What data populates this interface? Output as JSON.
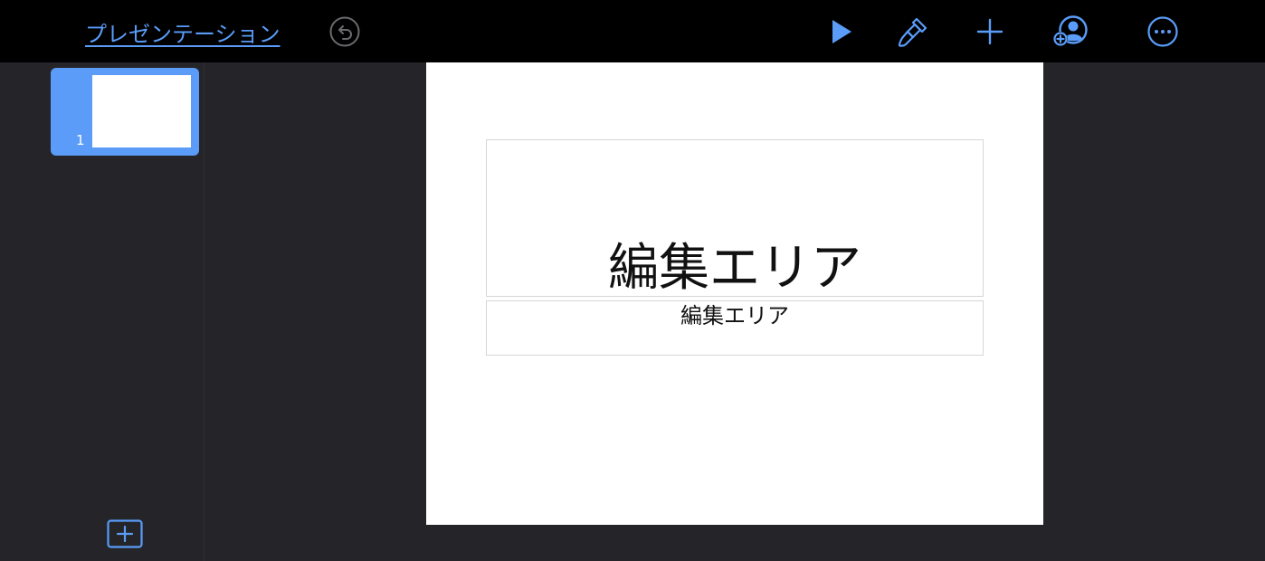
{
  "header": {
    "document_title": "プレゼンテーション",
    "undo_icon": "undo-icon",
    "play_icon": "play-icon",
    "format_icon": "paintbrush-icon",
    "add_icon": "plus-icon",
    "collaborate_icon": "add-person-icon",
    "more_icon": "ellipsis-circle-icon"
  },
  "sidebar": {
    "slides": [
      {
        "number": "1",
        "selected": true
      }
    ],
    "add_slide_icon": "plus-square-icon"
  },
  "slide": {
    "title": "編集エリア",
    "subtitle": "編集エリア"
  },
  "colors": {
    "accent": "#5a9cf8",
    "toolbar_bg": "#000000",
    "workspace_bg": "#252529",
    "slide_bg": "#ffffff",
    "placeholder_border": "#d6d6d6"
  }
}
